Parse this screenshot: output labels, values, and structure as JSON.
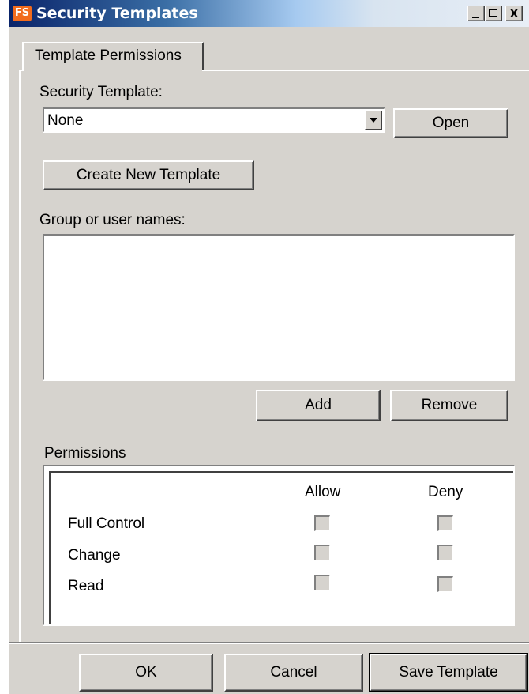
{
  "window": {
    "title": "Security Templates",
    "app_icon_text": "FS",
    "close_glyph": "X"
  },
  "tabs": [
    {
      "label": "Template Permissions",
      "selected": true
    }
  ],
  "security_template": {
    "label": "Security Template:",
    "selected_value": "None",
    "open_label": "Open"
  },
  "create_new_template_label": "Create New Template",
  "group_users": {
    "label": "Group or user names:",
    "items": [],
    "add_label": "Add",
    "remove_label": "Remove"
  },
  "permissions": {
    "label": "Permissions",
    "allow_header": "Allow",
    "deny_header": "Deny",
    "rows": [
      {
        "name": "Full Control",
        "allow": false,
        "deny": false
      },
      {
        "name": "Change",
        "allow": false,
        "deny": false
      },
      {
        "name": "Read",
        "allow": false,
        "deny": false
      }
    ]
  },
  "footer": {
    "ok_label": "OK",
    "cancel_label": "Cancel",
    "save_template_label": "Save Template"
  },
  "colors": {
    "dialog_face": "#d6d3ce",
    "title_gradient_start": "#0a246a",
    "app_icon": "#f26b1d"
  },
  "icons": {
    "app": "fs-app-icon",
    "minimize": "minimize-icon",
    "maximize": "maximize-icon",
    "close": "close-icon",
    "dropdown": "chevron-down-icon"
  }
}
